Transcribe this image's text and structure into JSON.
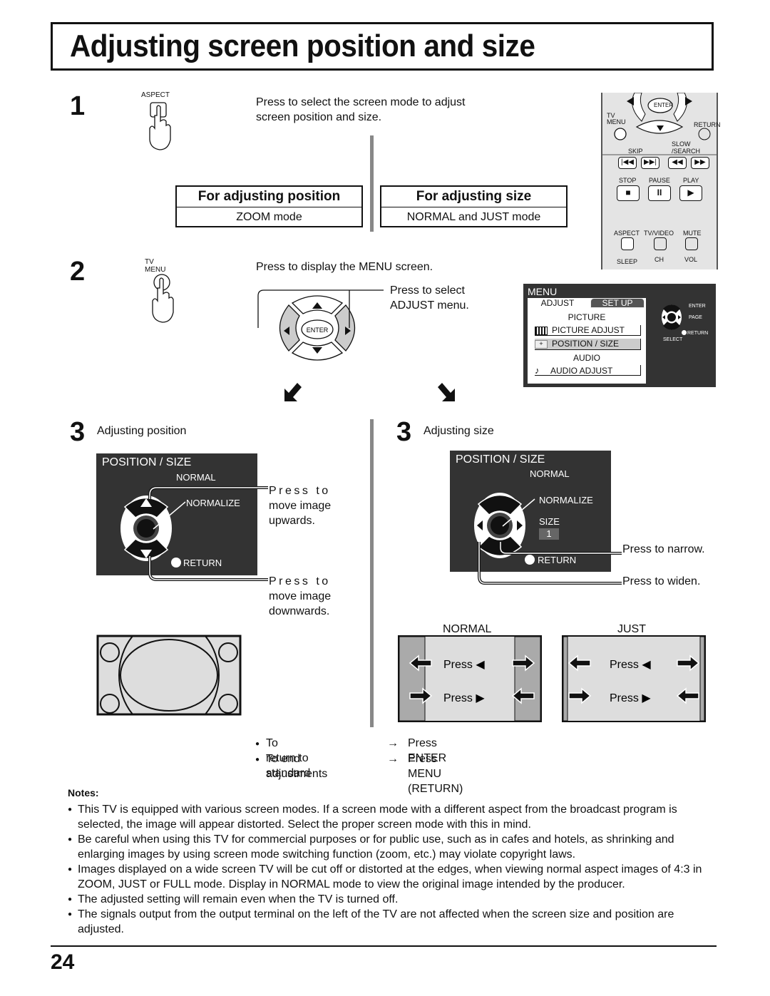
{
  "page": {
    "title": "Adjusting screen position and size",
    "page_number": "24"
  },
  "step1": {
    "number": "1",
    "button_label": "ASPECT",
    "instruction_line1": "Press to select the screen mode to adjust",
    "instruction_line2": "screen position and size."
  },
  "modes": {
    "position": {
      "heading": "For adjusting position",
      "mode": "ZOOM mode"
    },
    "size": {
      "heading": "For adjusting size",
      "mode": "NORMAL and JUST mode"
    }
  },
  "remote": {
    "enter": "ENTER",
    "tv_menu_line1": "TV",
    "tv_menu_line2": "MENU",
    "return": "RETURN",
    "skip": "SKIP",
    "slow": "SLOW",
    "search": "/SEARCH",
    "stop": "STOP",
    "pause": "PAUSE",
    "play": "PLAY",
    "aspect": "ASPECT",
    "tv_video": "TV/VIDEO",
    "mute": "MUTE",
    "sleep": "SLEEP",
    "ch": "CH",
    "vol": "VOL"
  },
  "step2": {
    "number": "2",
    "button_label_line1": "TV",
    "button_label_line2": "MENU",
    "instruction": "Press to display the MENU screen.",
    "select_line1": "Press to select",
    "select_line2": "ADJUST menu.",
    "enter_label": "ENTER"
  },
  "menu_screen": {
    "title": "MENU",
    "tabs": [
      "ADJUST",
      "SET UP"
    ],
    "items": [
      {
        "type": "header",
        "label": "PICTURE"
      },
      {
        "type": "item",
        "icon": "picture-icon",
        "label": "PICTURE  ADJUST"
      },
      {
        "type": "item",
        "icon": "position-icon",
        "label": "POSITION / SIZE",
        "selected": true
      },
      {
        "type": "header",
        "label": "AUDIO"
      },
      {
        "type": "item",
        "icon": "music-note-icon",
        "label": "AUDIO  ADJUST"
      }
    ],
    "legend": {
      "enter": "ENTER",
      "page": "PAGE",
      "return": "RETURN",
      "select": "SELECT"
    }
  },
  "step3_position": {
    "number": "3",
    "caption": "Adjusting position",
    "osd": {
      "title": "POSITION / SIZE",
      "mode": "NORMAL",
      "normalize": "NORMALIZE",
      "return": "RETURN"
    },
    "up_line1": "Press  to",
    "up_line2": "move image",
    "up_line3": "upwards.",
    "down_line1": "Press  to",
    "down_line2": "move image",
    "down_line3": "downwards."
  },
  "step3_size": {
    "number": "3",
    "caption": "Adjusting size",
    "osd": {
      "title": "POSITION / SIZE",
      "mode": "NORMAL",
      "normalize": "NORMALIZE",
      "size_label": "SIZE",
      "size_value": "1",
      "return": "RETURN"
    },
    "narrow": "Press to narrow.",
    "widen": "Press to widen."
  },
  "size_diagrams": {
    "normal": {
      "label": "NORMAL",
      "press_left": "Press ◀",
      "press_right": "Press ▶"
    },
    "just": {
      "label": "JUST",
      "press_left": "Press ◀",
      "press_right": "Press ▶"
    }
  },
  "shortcuts": [
    {
      "action": "To return to standard",
      "arrow": "→",
      "result": "Press ENTER"
    },
    {
      "action": "To end adjustments",
      "arrow": "→",
      "result": "Press MENU (RETURN)"
    }
  ],
  "notes": {
    "heading": "Notes:",
    "items": [
      "This TV is equipped with various screen modes. If a screen mode with a different aspect from the broadcast program is selected, the image will appear distorted. Select the proper screen mode with this in mind.",
      "Be careful when using this TV for commercial purposes or for public use, such as in cafes and hotels, as shrinking and enlarging images by using screen mode switching function (zoom, etc.) may violate copyright laws.",
      "Images displayed on a wide screen TV will be cut off or distorted at the edges, when viewing normal aspect images of 4:3 in ZOOM, JUST or FULL mode. Display in NORMAL mode to view the original image intended by the producer.",
      "The adjusted setting will remain even when the TV is turned off.",
      "The signals output from the output terminal on the left of the TV are not affected when the screen size and position are adjusted."
    ]
  }
}
